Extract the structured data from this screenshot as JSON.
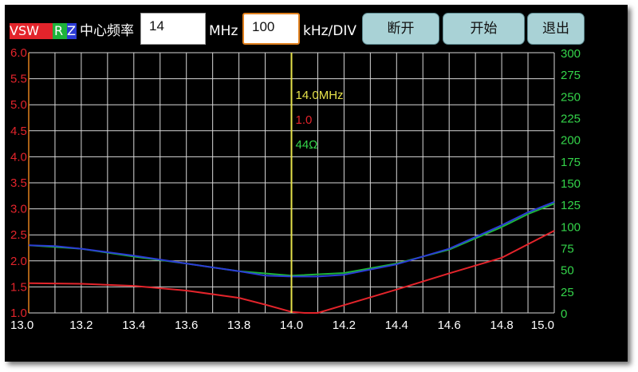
{
  "toolbar": {
    "legend": {
      "vsw": "VSW",
      "r": "R",
      "z": "Z"
    },
    "center_freq_label": "中心频率",
    "center_freq_value": "14",
    "center_freq_unit": "MHz",
    "span_value": "100",
    "span_unit": "kHz/DIV",
    "buttons": {
      "disconnect": "断开",
      "start": "开始",
      "exit": "退出"
    }
  },
  "colors": {
    "vsw": "#e3242b",
    "r": "#1eb33b",
    "z": "#2b3bd6",
    "marker": "#e6e24a",
    "right_axis": "#34d44a",
    "left_axis": "#e3242b"
  },
  "chart_data": {
    "type": "line",
    "xlim": [
      13.0,
      15.0
    ],
    "x_ticks": [
      "13.0",
      "13.2",
      "13.4",
      "13.6",
      "13.8",
      "14.0",
      "14.2",
      "14.4",
      "14.6",
      "14.8",
      "15.0"
    ],
    "left_axis": {
      "ylim": [
        1.0,
        6.0
      ],
      "ticks": [
        "1.0",
        "1.5",
        "2.0",
        "2.5",
        "3.0",
        "3.5",
        "4.0",
        "4.5",
        "5.0",
        "5.5",
        "6.0"
      ]
    },
    "right_axis": {
      "ylim": [
        0,
        300
      ],
      "ticks": [
        "0",
        "25",
        "50",
        "75",
        "100",
        "125",
        "150",
        "175",
        "200",
        "225",
        "250",
        "275",
        "300"
      ]
    },
    "grid": true,
    "series": [
      {
        "name": "VSW",
        "axis": "left",
        "color": "#e3242b",
        "x": [
          13.0,
          13.2,
          13.4,
          13.6,
          13.8,
          13.9,
          14.0,
          14.05,
          14.1,
          14.2,
          14.4,
          14.6,
          14.8,
          15.0
        ],
        "y": [
          1.57,
          1.56,
          1.52,
          1.43,
          1.29,
          1.16,
          1.02,
          1.0,
          1.0,
          1.15,
          1.45,
          1.76,
          2.06,
          2.58
        ]
      },
      {
        "name": "R",
        "axis": "right",
        "color": "#1eb33b",
        "x": [
          13.0,
          13.1,
          13.2,
          13.4,
          13.6,
          13.8,
          14.0,
          14.2,
          14.4,
          14.6,
          14.8,
          14.9,
          15.0
        ],
        "y": [
          78,
          76,
          74,
          65,
          57,
          48,
          43,
          46,
          57,
          73,
          99,
          114,
          126
        ]
      },
      {
        "name": "Z",
        "axis": "right",
        "color": "#2b3bd6",
        "x": [
          13.0,
          13.1,
          13.2,
          13.4,
          13.6,
          13.8,
          13.9,
          14.0,
          14.1,
          14.2,
          14.4,
          14.6,
          14.8,
          14.9,
          15.0
        ],
        "y": [
          78,
          77,
          74,
          66,
          57,
          48,
          43,
          42,
          42,
          44,
          56,
          74,
          101,
          116,
          128
        ]
      }
    ],
    "marker": {
      "x": 14.0,
      "labels": [
        "14.0MHz",
        "1.0",
        "44Ω"
      ],
      "label_colors": [
        "#e6e24a",
        "#e3242b",
        "#34d44a"
      ]
    }
  }
}
